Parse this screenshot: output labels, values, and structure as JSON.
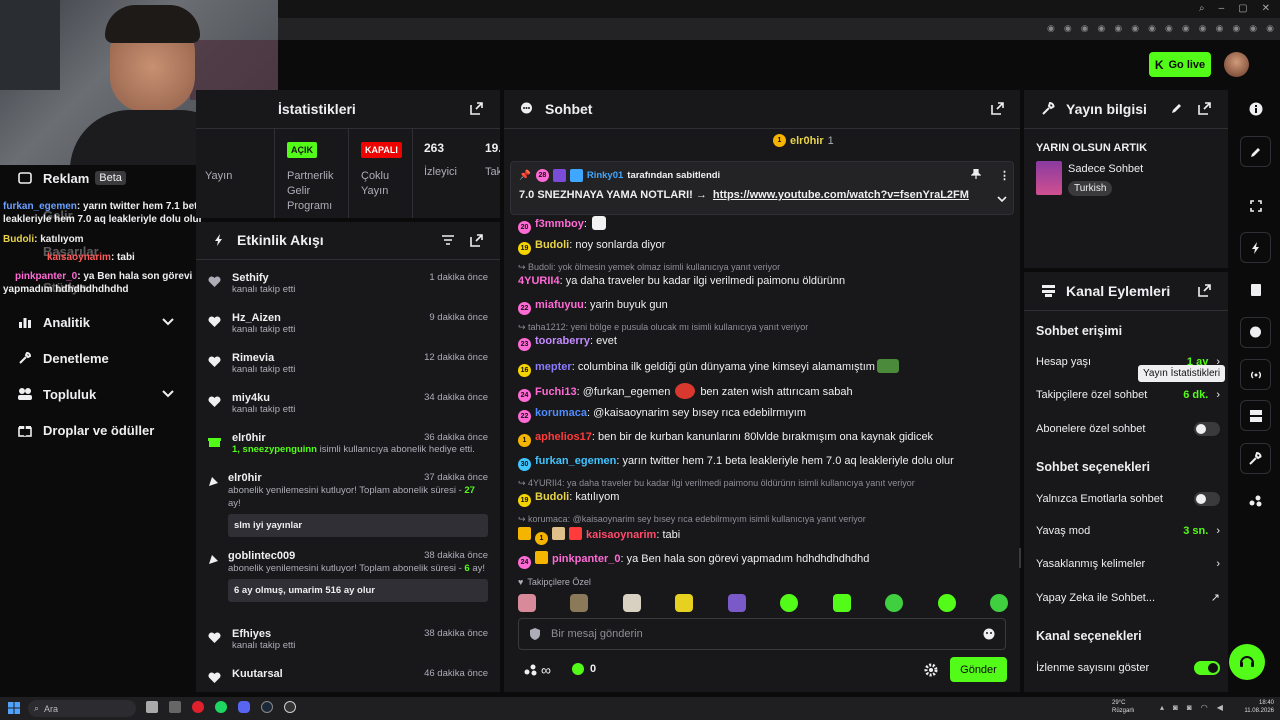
{
  "header": {
    "go_live": "Go live"
  },
  "sidebar": {
    "reklam": "Reklam",
    "beta": "Beta",
    "gelir": "Gelir",
    "basarilar": "Başarılar",
    "studyo": "Stüdyo",
    "analitik": "Analitik",
    "denetleme": "Denetleme",
    "topluluk": "Topluluk",
    "droplar": "Droplar ve ödüller"
  },
  "overlay": [
    {
      "user": "furkan_egemen",
      "text": ": yarın twitter hem 7.1 beta leakleriyle hem 7.0 aq leakleriyle dolu olur"
    },
    {
      "user": "Budoli",
      "text": ": katılıyom"
    },
    {
      "user": "kaisaoynarim",
      "text": ": tabi"
    },
    {
      "user": "pinkpanter_0",
      "text": ": ya Ben hala son görevi yapmadım hdhdhdhdhdhd"
    }
  ],
  "stats": {
    "title": "İstatistikleri",
    "yayin": "Yayın",
    "partner_badge": "AÇIK",
    "partner_label": "Partnerlik Gelir Programı",
    "multi_badge": "KAPALI",
    "multi_label": "Çoklu Yayın",
    "viewers_value": "263",
    "viewers_label": "İzleyici",
    "more_value": "19.",
    "more_label": "Tak"
  },
  "activity": {
    "title": "Etkinlik Akışı",
    "items": [
      {
        "name": "Sethify",
        "sub": "kanalı takip etti",
        "time": "1 dakika önce"
      },
      {
        "name": "Hz_Aizen",
        "sub": "kanalı takip etti",
        "time": "9 dakika önce"
      },
      {
        "name": "Rimevia",
        "sub": "kanalı takip etti",
        "time": "12 dakika önce"
      },
      {
        "name": "miy4ku",
        "sub": "kanalı takip etti",
        "time": "34 dakika önce"
      },
      {
        "name": "elr0hir",
        "sub_green": "1, sneezypenguinn",
        "sub": " isimli kullanıcıya abonelik hediye etti.",
        "time": "36 dakika önce"
      },
      {
        "name": "elr0hir",
        "sub": "abonelik yenilemesini kutluyor! Toplam abonelik süresi - ",
        "sub_green": "27",
        "sub2": " ay!",
        "box": "slm iyi yayınlar",
        "time": "37 dakika önce"
      },
      {
        "name": "goblintec009",
        "sub": "abonelik yenilemesini kutluyor! Toplam abonelik süresi - ",
        "sub_green": "6",
        "sub2": " ay!",
        "box": "6 ay olmuş, umarim 516 ay olur",
        "time": "38 dakika önce"
      },
      {
        "name": "Efhiyes",
        "sub": "kanalı takip etti",
        "time": "38 dakika önce"
      },
      {
        "name": "Kuutarsal",
        "sub": "",
        "time": "46 dakika önce"
      }
    ]
  },
  "chat": {
    "title": "Sohbet",
    "top_user": "elr0hir",
    "top_count": "1",
    "pinned_by": "Rinky01",
    "pinned_suffix": "tarafından sabitlendi",
    "pinned_text": "7.0 SNEZHNAYA YAMA NOTLARI! →",
    "pinned_link": "https://www.youtube.com/watch?v=fsenYraL2FM",
    "messages": [
      {
        "badge": "20",
        "user": "f3mmboy",
        "text": ""
      },
      {
        "badge": "19",
        "user": "Budoli",
        "text": "noy sonlarda diyor"
      },
      {
        "reply": "Budoli: yok ölmesin yemek olmaz isimli kullanıcıya yanıt veriyor"
      },
      {
        "user": "4YURII4",
        "text": "ya daha traveler bu kadar ilgi verilmedi paimonu öldürünn"
      },
      {
        "badge": "22",
        "user": "miafuyuu",
        "text": "yarin buyuk gun"
      },
      {
        "reply": "taha1212: yeni bölge e pusula olucak mı isimli kullanıcıya yanıt veriyor"
      },
      {
        "badge": "23",
        "user": "tooraberry",
        "text": "evet"
      },
      {
        "badge": "16",
        "user": "mepter",
        "text": "columbina ilk geldiği gün dünyama yine kimseyi alamamıştım"
      },
      {
        "badge": "24",
        "user": "Fuchi13",
        "text": "@furkan_egemen",
        "text2": "ben zaten wish attırıcam sabah"
      },
      {
        "badge": "22",
        "user": "korumaca",
        "text": "@kaisaoynarim sey bısey rıca edebilrmıyım"
      },
      {
        "badge": "1",
        "user": "aphelios17",
        "text": "ben bir de kurban kanunlarını 80lvlde bırakmışım ona kaynak gidicek"
      },
      {
        "badge": "30",
        "user": "furkan_egemen",
        "text": "yarın twitter hem 7.1 beta leakleriyle hem 7.0 aq leakleriyle dolu olur"
      },
      {
        "reply": "4YURII4: ya daha traveler bu kadar ilgi verilmedi paimonu öldürünn isimli kullanıcıya yanıt veriyor"
      },
      {
        "badge": "19",
        "user": "Budoli",
        "text": "katılıyom"
      },
      {
        "reply": "korumaca: @kaisaoynarim sey bısey rıca edebilrmıyım isimli kullanıcıya yanıt veriyor"
      },
      {
        "badge": "1",
        "user": "kaisaoynarim",
        "text": "tabi"
      },
      {
        "badge": "24",
        "user": "pinkpanter_0",
        "text": "ya Ben hala son görevi yapmadım hdhdhdhdhdhd"
      }
    ],
    "followers_only": "Takipçilere Özel",
    "input_placeholder": "Bir mesaj gönderin",
    "points": "0",
    "infinity": "∞",
    "send": "Gönder"
  },
  "info": {
    "title": "Yayın bilgisi",
    "stream_title": "YARIN OLSUN ARTIK",
    "category": "Sadece Sohbet",
    "language": "Turkish"
  },
  "channel": {
    "title": "Kanal Eylemleri",
    "chat_access": "Sohbet erişimi",
    "account_age": "Hesap yaşı",
    "account_age_val": "1 ay",
    "followers_chat": "Takipçilere özel sohbet",
    "followers_chat_val": "6 dk.",
    "subs_chat": "Abonelere özel sohbet",
    "chat_options": "Sohbet seçenekleri",
    "emote_only": "Yalnızca Emotlarla sohbet",
    "slow_mode": "Yavaş mod",
    "slow_mode_val": "3 sn.",
    "banned_words": "Yasaklanmış kelimeler",
    "ai_chat": "Yapay Zeka ile Sohbet...",
    "channel_options": "Kanal seçenekleri",
    "show_views": "İzlenme sayısını göster"
  },
  "tooltip": "Yayın İstatistikleri",
  "taskbar": {
    "search": "Ara",
    "weather_temp": "29°C",
    "weather_desc": "Rüzgarlı",
    "time": "18:40",
    "date": "11.08.2026"
  },
  "colors": {
    "accent": "#53fc18",
    "panel": "#18181b",
    "bg": "#0b0b0c"
  }
}
